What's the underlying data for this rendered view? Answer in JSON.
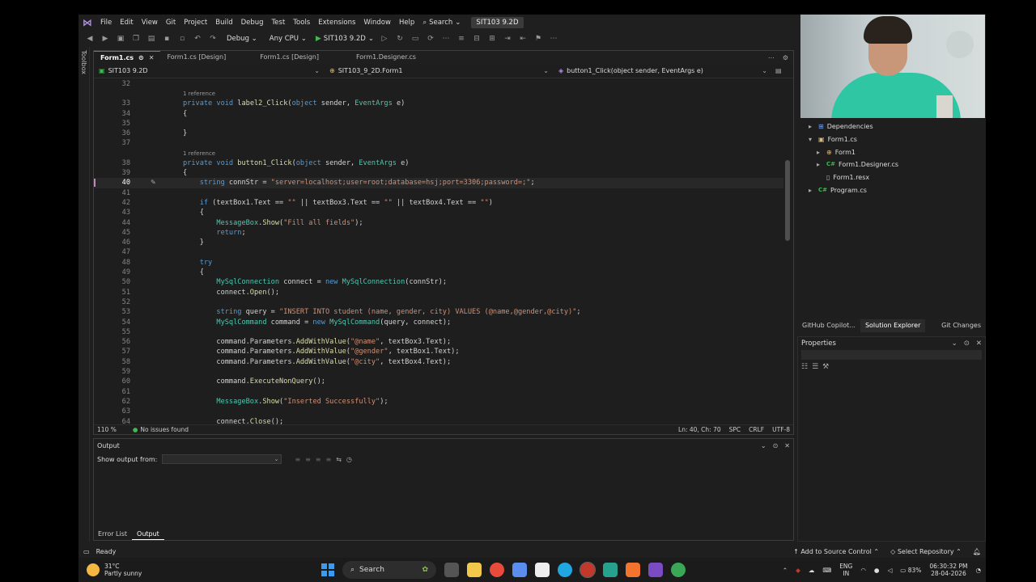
{
  "menu": {
    "items": [
      "File",
      "Edit",
      "View",
      "Git",
      "Project",
      "Build",
      "Debug",
      "Test",
      "Tools",
      "Extensions",
      "Window",
      "Help"
    ],
    "search_label": "Search",
    "solution_title": "SIT103 9.2D"
  },
  "toolbar": {
    "config": "Debug",
    "platform": "Any CPU",
    "run_target": "SIT103 9.2D"
  },
  "toolbox_label": "Toolbox",
  "tabs": [
    {
      "label": "Form1.cs",
      "active": true
    },
    {
      "label": "Form1.cs [Design]",
      "active": false
    },
    {
      "label": "Form1.cs [Design]",
      "active": false
    },
    {
      "label": "Form1.Designer.cs",
      "active": false
    }
  ],
  "navbar": {
    "project": "SIT103 9.2D",
    "class": "SIT103_9_2D.Form1",
    "member": "button1_Click(object sender, EventArgs e)"
  },
  "code": {
    "reference_label": "1 reference",
    "lines": [
      {
        "n": "32",
        "text": ""
      },
      {
        "ref": true
      },
      {
        "n": "33",
        "text": "private void label2_Click(object sender, EventArgs e)"
      },
      {
        "n": "34",
        "text": "{"
      },
      {
        "n": "35",
        "text": ""
      },
      {
        "n": "36",
        "text": "}"
      },
      {
        "n": "37",
        "text": ""
      },
      {
        "ref": true
      },
      {
        "n": "38",
        "text": "private void button1_Click(object sender, EventArgs e)"
      },
      {
        "n": "39",
        "text": "{"
      },
      {
        "n": "40",
        "text": "    string connStr = \"server=localhost;user=root;database=hsj;port=3306;password=;\";",
        "current": true
      },
      {
        "n": "41",
        "text": ""
      },
      {
        "n": "42",
        "text": "    if (textBox1.Text == \"\" || textBox3.Text == \"\" || textBox4.Text == \"\")"
      },
      {
        "n": "43",
        "text": "    {"
      },
      {
        "n": "44",
        "text": "        MessageBox.Show(\"Fill all fields\");"
      },
      {
        "n": "45",
        "text": "        return;"
      },
      {
        "n": "46",
        "text": "    }"
      },
      {
        "n": "47",
        "text": ""
      },
      {
        "n": "48",
        "text": "    try"
      },
      {
        "n": "49",
        "text": "    {"
      },
      {
        "n": "50",
        "text": "        MySqlConnection connect = new MySqlConnection(connStr);"
      },
      {
        "n": "51",
        "text": "        connect.Open();"
      },
      {
        "n": "52",
        "text": ""
      },
      {
        "n": "53",
        "text": "        string query = \"INSERT INTO student (name, gender, city) VALUES (@name,@gender,@city)\";"
      },
      {
        "n": "54",
        "text": "        MySqlCommand command = new MySqlCommand(query, connect);"
      },
      {
        "n": "55",
        "text": ""
      },
      {
        "n": "56",
        "text": "        command.Parameters.AddWithValue(\"@name\", textBox3.Text);"
      },
      {
        "n": "57",
        "text": "        command.Parameters.AddWithValue(\"@gender\", textBox1.Text);"
      },
      {
        "n": "58",
        "text": "        command.Parameters.AddWithValue(\"@city\", textBox4.Text);"
      },
      {
        "n": "59",
        "text": ""
      },
      {
        "n": "60",
        "text": "        command.ExecuteNonQuery();"
      },
      {
        "n": "61",
        "text": ""
      },
      {
        "n": "62",
        "text": "        MessageBox.Show(\"Inserted Successfully\");"
      },
      {
        "n": "63",
        "text": ""
      },
      {
        "n": "64",
        "text": "        connect.Close();"
      }
    ]
  },
  "editor_status": {
    "zoom": "110 %",
    "issues": "No issues found",
    "position": "Ln: 40, Ch: 70",
    "whitespace": "SPC",
    "eol": "CRLF",
    "encoding": "UTF-8"
  },
  "output": {
    "title": "Output",
    "show_from_label": "Show output from:",
    "selected": ""
  },
  "bottom_tabs": [
    "Error List",
    "Output"
  ],
  "solution_tree": [
    {
      "label": "Dependencies",
      "indent": 0,
      "icon": "dependencies-icon",
      "arrow": "▸"
    },
    {
      "label": "Form1.cs",
      "indent": 0,
      "icon": "form-icon",
      "arrow": "▾"
    },
    {
      "label": "Form1",
      "indent": 1,
      "icon": "class-icon",
      "arrow": "▸"
    },
    {
      "label": "Form1.Designer.cs",
      "indent": 1,
      "icon": "csharp-icon",
      "arrow": "▸"
    },
    {
      "label": "Form1.resx",
      "indent": 1,
      "icon": "file-icon",
      "arrow": ""
    },
    {
      "label": "Program.cs",
      "indent": 0,
      "icon": "csharp-icon",
      "arrow": "▸"
    }
  ],
  "side_tabs": [
    "GitHub Copilot...",
    "Solution Explorer",
    "Git Changes"
  ],
  "properties": {
    "title": "Properties"
  },
  "status": {
    "ready": "Ready",
    "source_control": "Add to Source Control",
    "repository": "Select Repository"
  },
  "taskbar": {
    "temperature": "31°C",
    "weather": "Partly sunny",
    "search": "Search",
    "lang_top": "ENG",
    "lang_bottom": "IN",
    "battery": "83%",
    "time": "06:30:32 PM",
    "date": "28-04-2026"
  },
  "colors": {
    "accent": "#6b6bd6",
    "keyword": "#569cd6",
    "type": "#4ec9b0",
    "string": "#ce9178",
    "method": "#dcdcaa",
    "ok": "#3fb950"
  }
}
